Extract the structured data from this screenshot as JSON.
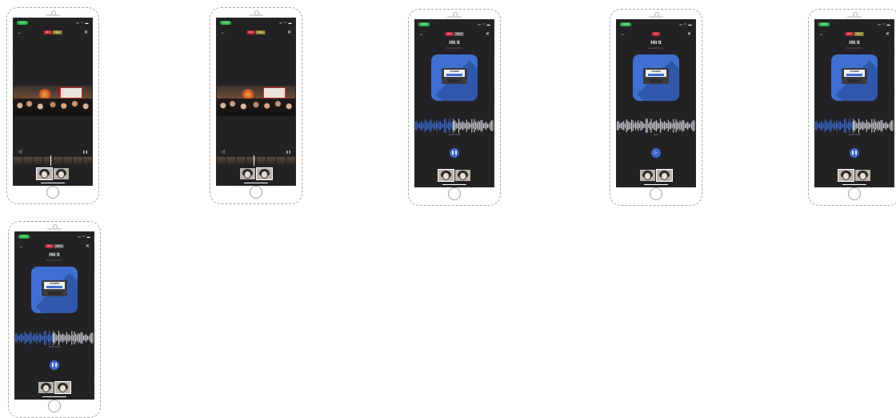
{
  "status_bar": {
    "time": "12:34",
    "icons": "▪▪ ◠ ▬"
  },
  "top_bar": {
    "tab_primary": "Hit It",
    "tab_secondary": "Video"
  },
  "audio": {
    "title": "Hit It",
    "subtitle": "Ben Dusk Film",
    "cassette_label": "7TAMPS",
    "timestamps": "00:03 / 00:38",
    "timestamps_paused": "00:07"
  },
  "controls": {
    "pause_icon": "❚❚",
    "play_icon": "▷",
    "back_icon": "←",
    "close_icon": "✕",
    "volume_icon": "◁)",
    "small_pause_icon": "❚❚"
  },
  "colors": {
    "screen_bg": "#222225",
    "accent_blue": "#3c67c8",
    "tab_red": "#c0242f",
    "tab_gold": "#8f8430",
    "status_green": "#2bb34a"
  }
}
